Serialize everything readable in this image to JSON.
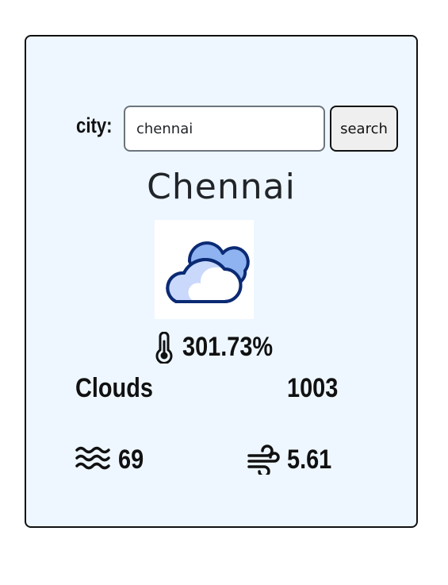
{
  "search": {
    "label": "city:",
    "value": "chennai",
    "button_label": "search"
  },
  "weather": {
    "city": "Chennai",
    "condition_icon": "cloud-icon",
    "temperature": "301.73%",
    "condition": "Clouds",
    "pressure": "1003",
    "humidity": "69",
    "wind_speed": "5.61"
  },
  "colors": {
    "card_background": "#eef7ff",
    "cloud_fill": "#91b6f2",
    "cloud_outline": "#0b2a74"
  }
}
